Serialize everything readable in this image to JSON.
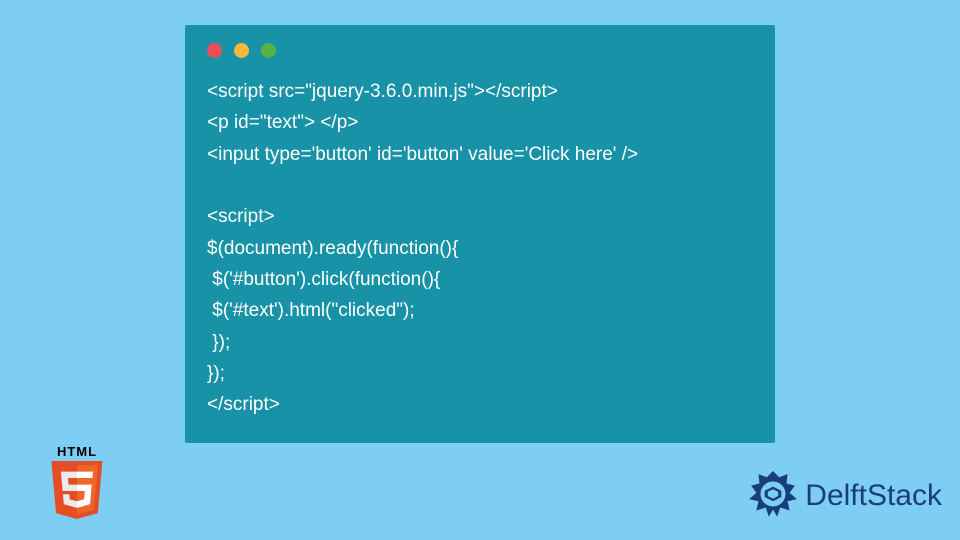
{
  "code": {
    "lines": [
      "<script src=\"jquery-3.6.0.min.js\"></script>",
      "<p id=\"text\"> </p>",
      "<input type='button' id='button' value='Click here' />",
      "",
      "<script>",
      "$(document).ready(function(){",
      " $('#button').click(function(){",
      " $('#text').html(\"clicked\");",
      " });",
      "});",
      "</script>"
    ]
  },
  "window": {
    "dot_red": "#e94f55",
    "dot_yellow": "#f4b83f",
    "dot_green": "#57b147"
  },
  "badges": {
    "html5_label": "HTML",
    "delftstack_label": "DelftStack"
  }
}
